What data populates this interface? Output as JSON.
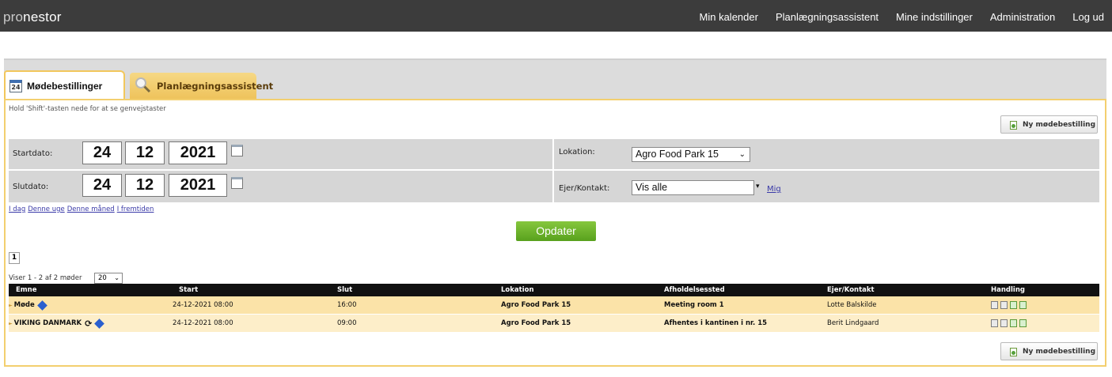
{
  "app": {
    "logo_prefix": "pro",
    "logo_rest": "nestor"
  },
  "topnav": [
    "Min kalender",
    "Planlægningsassistent",
    "Mine indstillinger",
    "Administration",
    "Log ud"
  ],
  "tabs": {
    "active": "Mødebestillinger",
    "inactive": "Planlægningsassistent",
    "calendar_day": "24"
  },
  "hint": "Hold 'Shift'-tasten nede for at se genvejstaster",
  "new_booking_label": "Ny mødebestilling",
  "filters": {
    "start_label": "Startdato:",
    "start": {
      "day": "24",
      "month": "12",
      "year": "2021"
    },
    "end_label": "Slutdato:",
    "end": {
      "day": "24",
      "month": "12",
      "year": "2021"
    },
    "location_label": "Lokation:",
    "location_value": "Agro Food Park 15",
    "owner_label": "Ejer/Kontakt:",
    "owner_value": "Vis alle",
    "owner_me_link": "Mig"
  },
  "quick_links": [
    "I dag",
    "Denne uge",
    "Denne måned",
    "I fremtiden"
  ],
  "update_label": "Opdater",
  "pagination": {
    "current_page": "1",
    "summary": "Viser 1 - 2 af 2 møder",
    "per_page": "20"
  },
  "table": {
    "headers": [
      "Emne",
      "Start",
      "Slut",
      "Lokation",
      "Afholdelsessted",
      "Ejer/Kontakt",
      "Handling"
    ],
    "rows": [
      {
        "subject": "Møde",
        "start": "24-12-2021 08:00",
        "end": "16:00",
        "location": "Agro Food Park 15",
        "venue": "Meeting room 1",
        "owner": "Lotte Balskilde",
        "recurring": false
      },
      {
        "subject": "VIKING DANMARK",
        "start": "24-12-2021 08:00",
        "end": "09:00",
        "location": "Agro Food Park 15",
        "venue": "Afhentes i kantinen i nr. 15",
        "owner": "Berit Lindgaard",
        "recurring": true
      }
    ]
  },
  "colors": {
    "topbar": "#3c3c3c",
    "accent_border": "#f3cf6f",
    "row": "#fbe3a8",
    "update_button": "#6ab52b",
    "link": "#3a3aa8"
  }
}
